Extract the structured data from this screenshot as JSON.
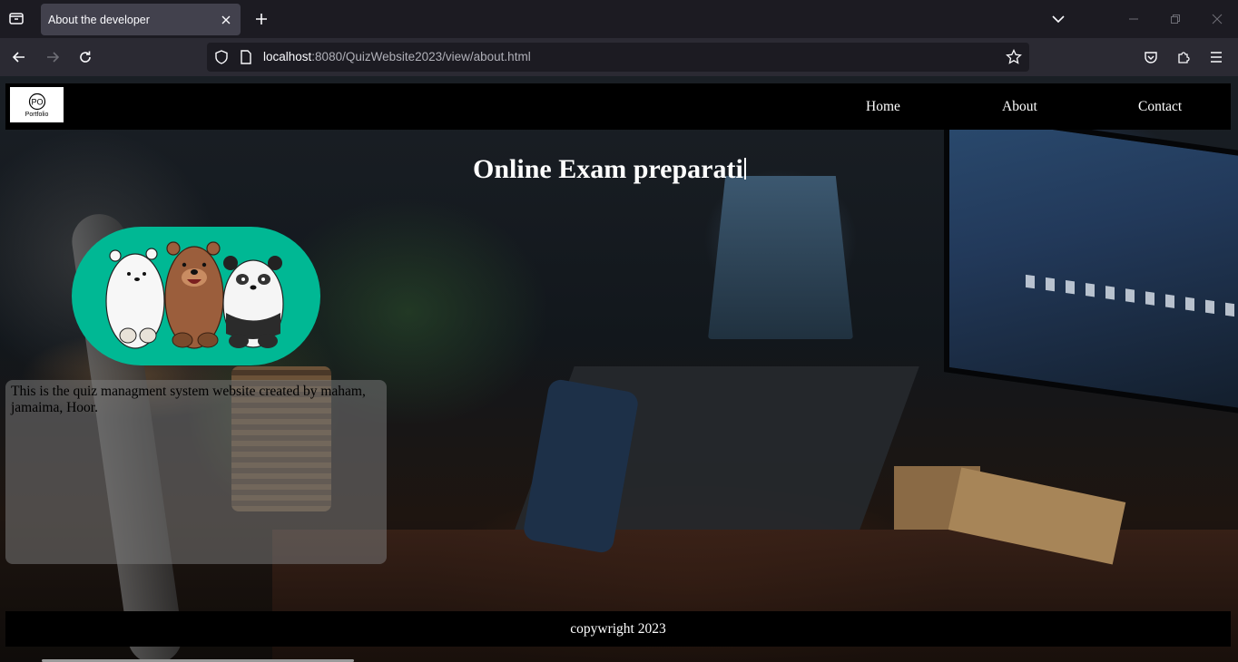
{
  "browser": {
    "tab_title": "About the developer",
    "url_host": "localhost",
    "url_rest": ":8080/QuizWebsite2023/view/about.html"
  },
  "site": {
    "logo_text": "Portfolio",
    "logo_monogram": "PO",
    "nav": {
      "home": "Home",
      "about": "About",
      "contact": "Contact"
    },
    "hero_title": "Online Exam preparati",
    "about_text": "This is the quiz managment system website created by maham, jamaima, Hoor.",
    "footer_text": "copywright 2023",
    "colors": {
      "header_bg": "#000000",
      "avatar_bg": "#00b894",
      "card_bg": "rgba(120,120,120,0.55)"
    }
  }
}
